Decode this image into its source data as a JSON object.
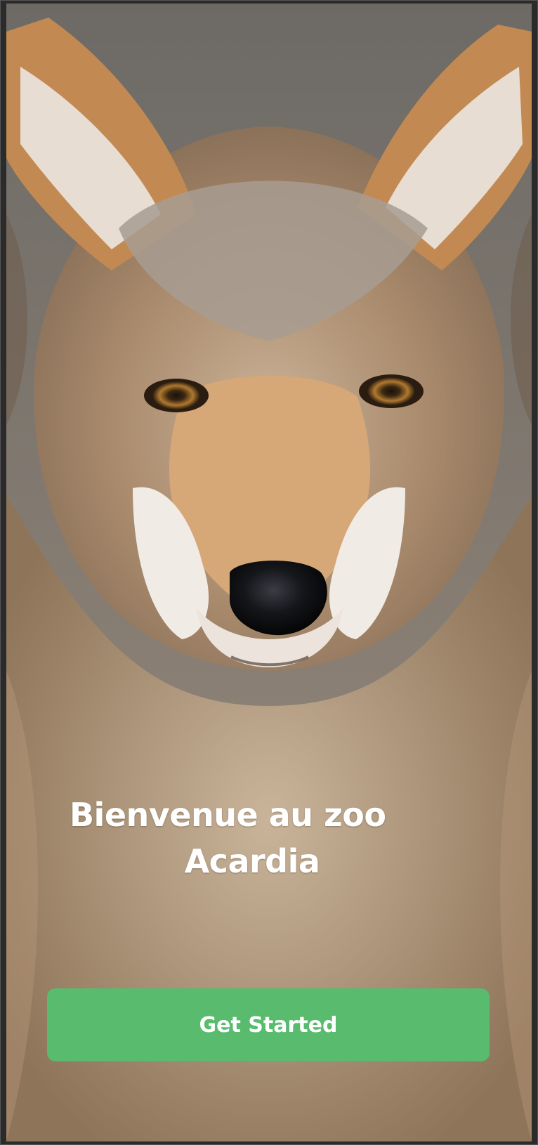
{
  "hero": {
    "image_subject": "wolf-portrait"
  },
  "welcome": {
    "line1": "Bienvenue au zoo",
    "line2": "Acardia"
  },
  "cta": {
    "label": "Get Started",
    "color": "#58bb6e"
  }
}
